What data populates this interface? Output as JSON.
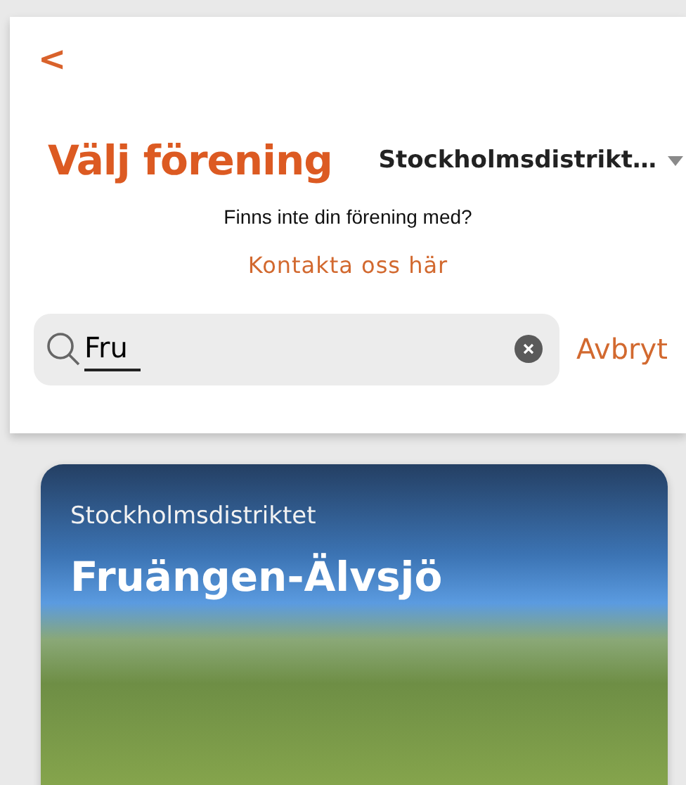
{
  "back_button": {
    "label": "<"
  },
  "header": {
    "title": "Välj förening",
    "district_dropdown": "Stockholmsdistrikt…"
  },
  "prompt": {
    "text": "Finns inte din förening med?",
    "link": "Kontakta oss här"
  },
  "search": {
    "value": "Fru",
    "cancel": "Avbryt"
  },
  "results": [
    {
      "district": "Stockholmsdistriktet",
      "name": "Fruängen-Älvsjö"
    }
  ]
}
